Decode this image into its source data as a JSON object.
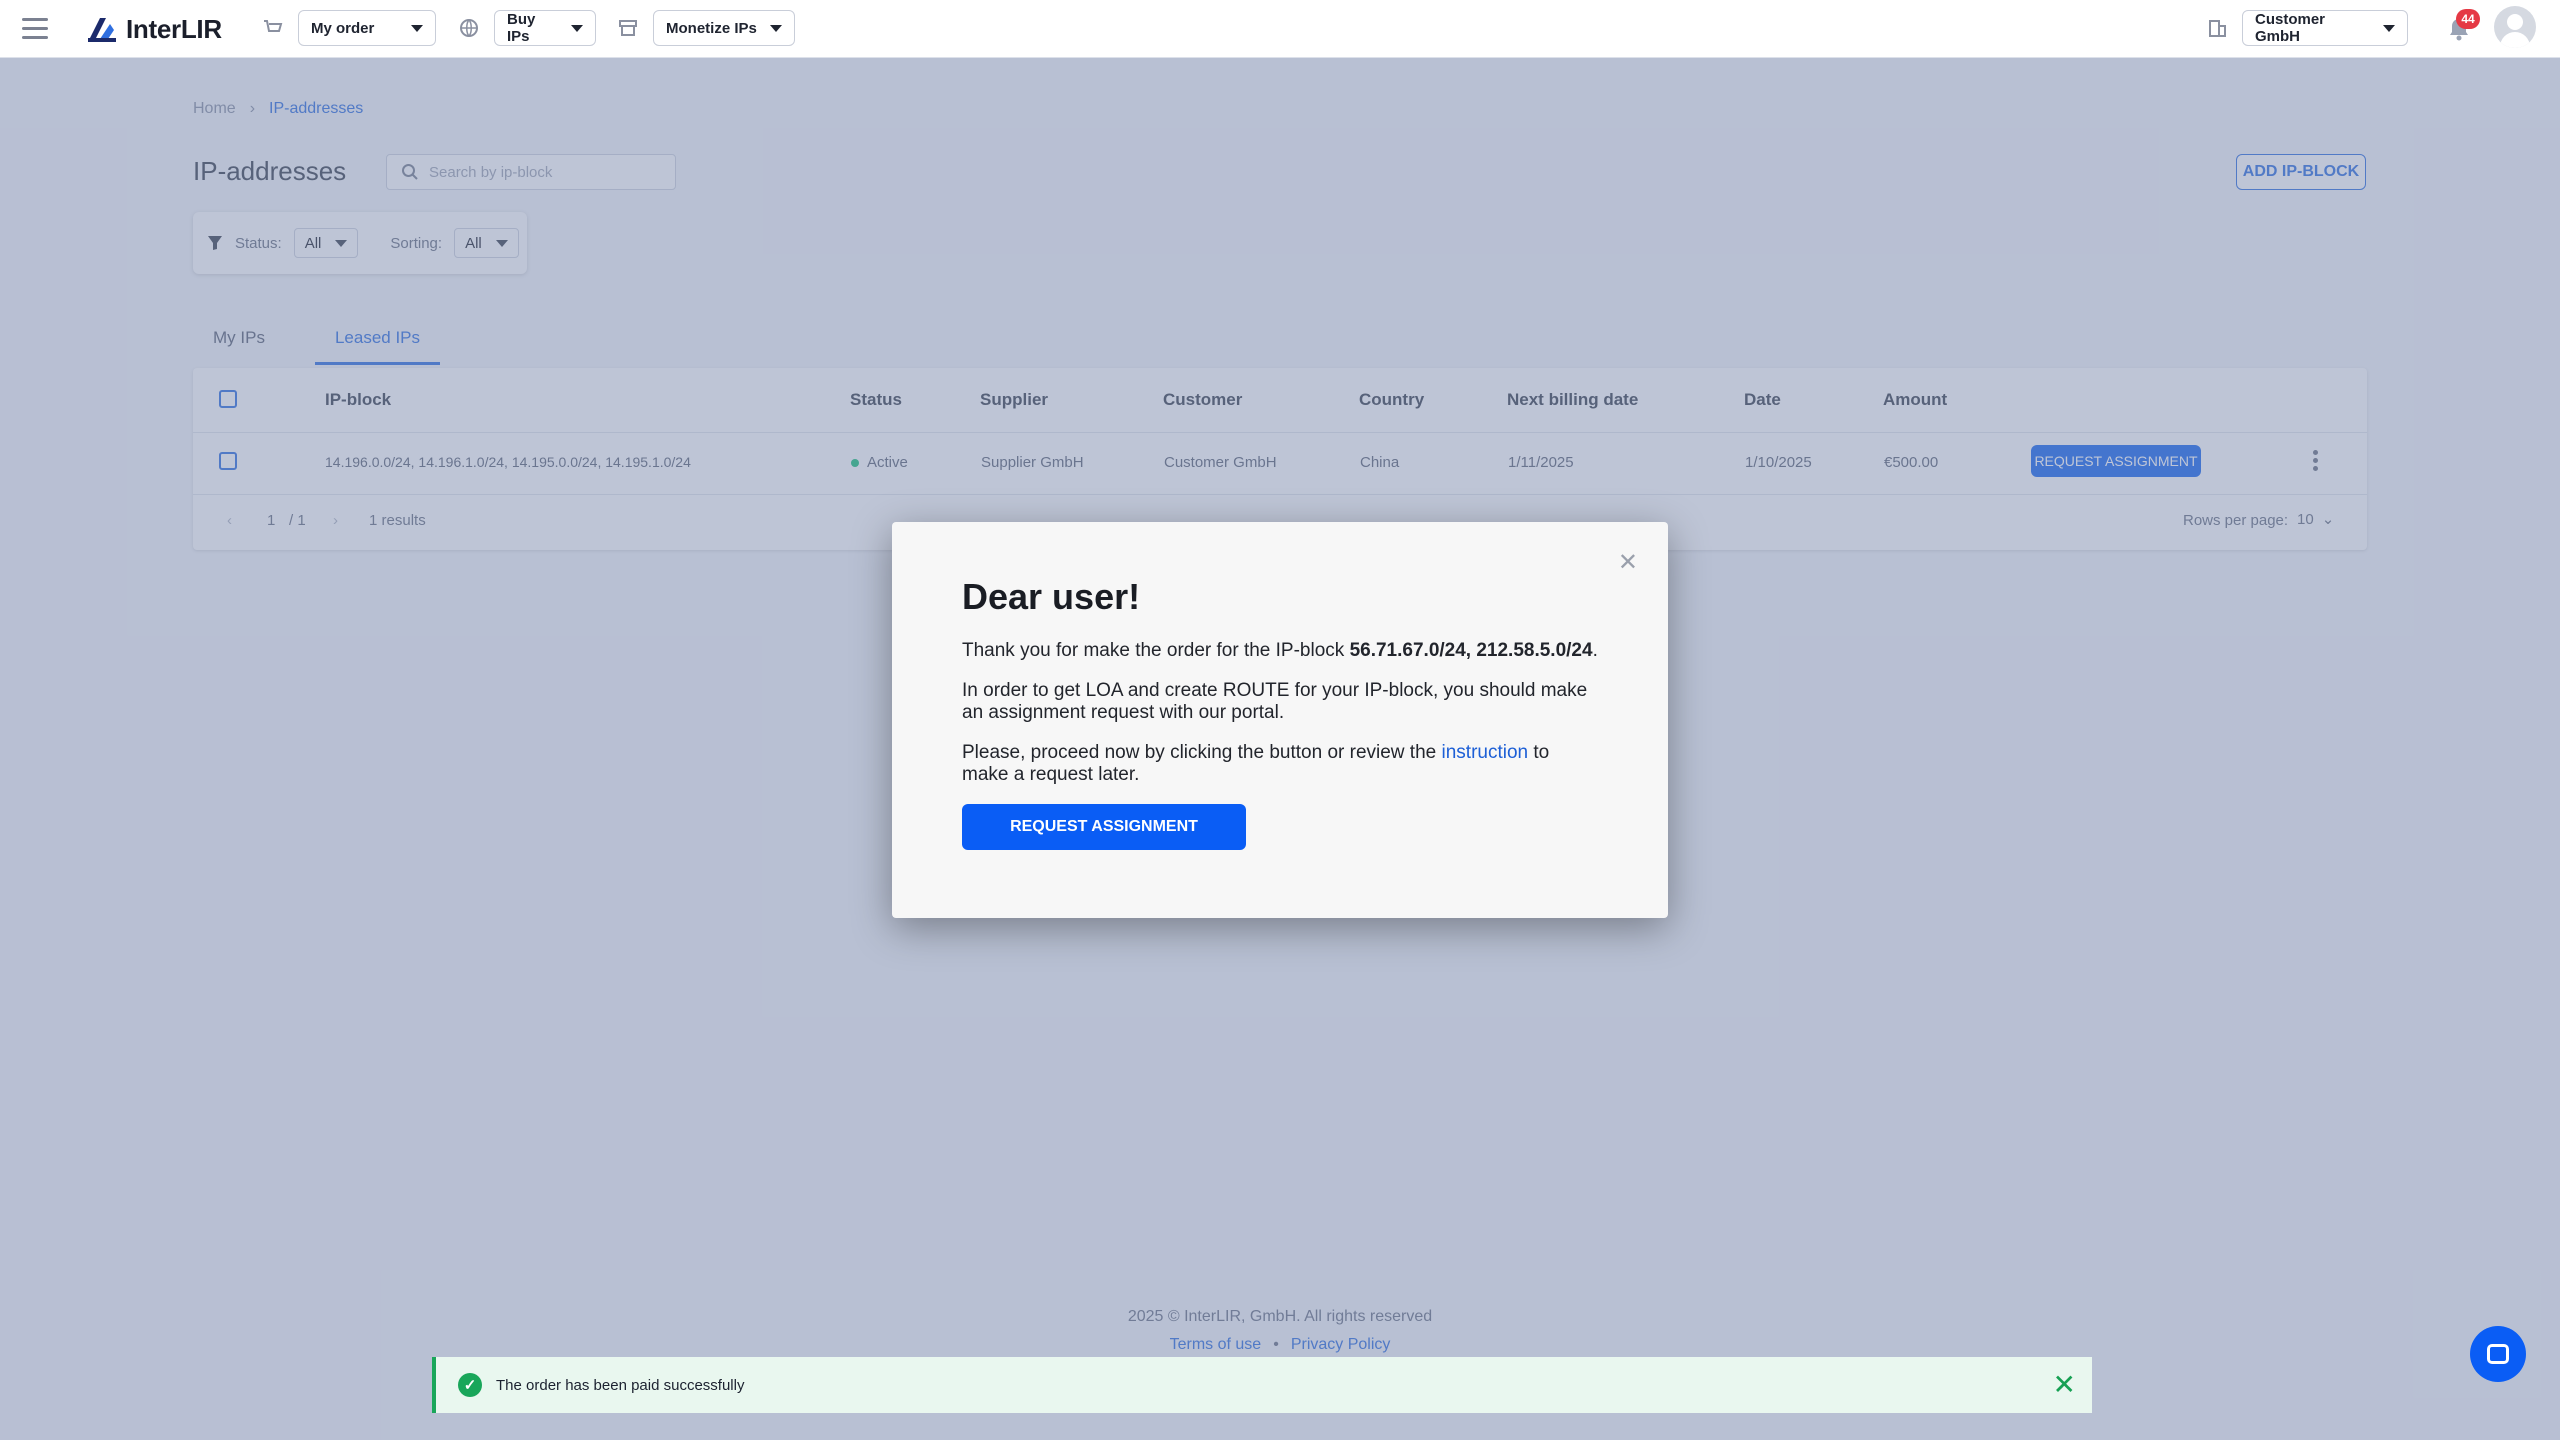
{
  "header": {
    "logo_text": "InterLIR",
    "my_order_label": "My order",
    "buy_ips_label": "Buy IPs",
    "monetize_ips_label": "Monetize IPs",
    "company_label": "Customer GmbH",
    "notification_count": "44"
  },
  "breadcrumb": {
    "home": "Home",
    "current": "IP-addresses"
  },
  "page": {
    "title": "IP-addresses",
    "search_placeholder": "Search by ip-block",
    "add_button": "ADD IP-BLOCK"
  },
  "filters": {
    "status_label": "Status:",
    "status_value": "All",
    "sorting_label": "Sorting:",
    "sorting_value": "All"
  },
  "tabs": [
    {
      "label": "My IPs"
    },
    {
      "label": "Leased IPs"
    }
  ],
  "table": {
    "headers": [
      "IP-block",
      "Status",
      "Supplier",
      "Customer",
      "Country",
      "Next billing date",
      "Date",
      "Amount"
    ],
    "rows": [
      {
        "ip_block": "14.196.0.0/24, 14.196.1.0/24, 14.195.0.0/24, 14.195.1.0/24",
        "status": "Active",
        "supplier": "Supplier GmbH",
        "customer": "Customer GmbH",
        "country": "China",
        "next_billing": "1/11/2025",
        "date": "1/10/2025",
        "amount": "€500.00",
        "action": "REQUEST ASSIGNMENT"
      }
    ],
    "pagination": {
      "page": "1",
      "total": "/ 1",
      "results": "1 results"
    },
    "rows_per_page_label": "Rows per page:",
    "rows_per_page_value": "10"
  },
  "footer": {
    "copyright": "2025 © InterLIR, GmbH. All rights reserved",
    "terms": "Terms of use",
    "separator": "•",
    "privacy": "Privacy Policy"
  },
  "modal": {
    "title": "Dear user!",
    "p1_prefix": "Thank you for make the order for the IP-block ",
    "p1_blocks": "56.71.67.0/24, 212.58.5.0/24",
    "p1_suffix": ".",
    "p2": "In order to get LOA and create ROUTE for your IP-block, you should make an assignment request with our portal.",
    "p3_prefix": "Please, proceed now by clicking the button or review the ",
    "p3_link": "instruction",
    "p3_suffix": " to make a request later.",
    "button": "REQUEST ASSIGNMENT"
  },
  "toast": {
    "message": "The order has been paid successfully"
  },
  "colors": {
    "accent": "#0a5df5",
    "success": "#19a65a",
    "badge": "#e53945"
  }
}
